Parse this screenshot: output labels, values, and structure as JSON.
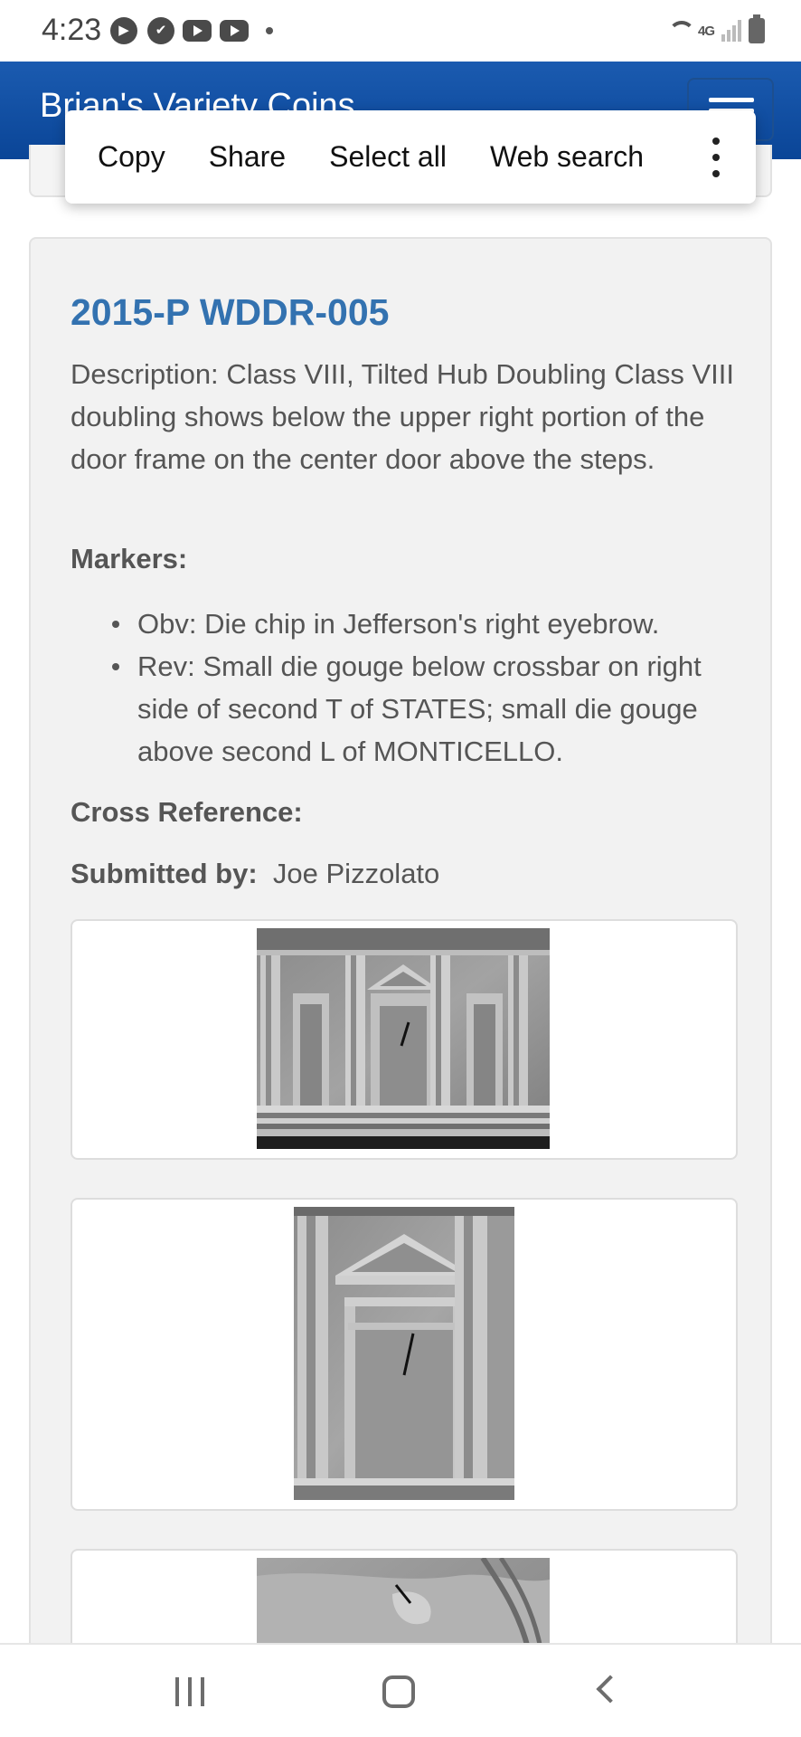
{
  "status_bar": {
    "time": "4:23",
    "icons": [
      "play-icon",
      "check-icon",
      "youtube-icon",
      "youtube-icon",
      "dot-icon"
    ],
    "network": "4G",
    "right_icons": [
      "wifi-icon",
      "signal-icon",
      "battery-icon"
    ]
  },
  "header": {
    "brand": "Brian's Variety Coins",
    "menu_icon": "hamburger-icon"
  },
  "selection_menu": {
    "items": [
      "Copy",
      "Share",
      "Select all",
      "Web search"
    ],
    "more_icon": "more-vertical-icon"
  },
  "variety": {
    "title": "2015-P WDDR-005",
    "description_label": "Description:",
    "description": "Class VIII, Tilted Hub Doubling Class VIII doubling shows below the upper right portion of the door frame on the center door above the steps.",
    "markers_label": "Markers:",
    "markers": [
      "Obv:  Die chip in Jefferson's right eyebrow.",
      "Rev:  Small die gouge below crossbar on right side of second T of STATES; small die gouge above second L of MONTICELLO."
    ],
    "cross_reference_label": "Cross Reference:",
    "submitted_label": "Submitted by:",
    "submitted_by": "Joe Pizzolato"
  },
  "images": [
    {
      "alt": "monticello-reverse-closeup"
    },
    {
      "alt": "center-door-closeup"
    },
    {
      "alt": "obverse-eyebrow-closeup"
    }
  ],
  "nav_bar": {
    "icons": [
      "recent-apps-icon",
      "home-icon",
      "back-icon"
    ]
  },
  "colors": {
    "header_blue": "#0a4597",
    "title_blue": "#3372b0",
    "card_bg": "#f2f2f2"
  }
}
